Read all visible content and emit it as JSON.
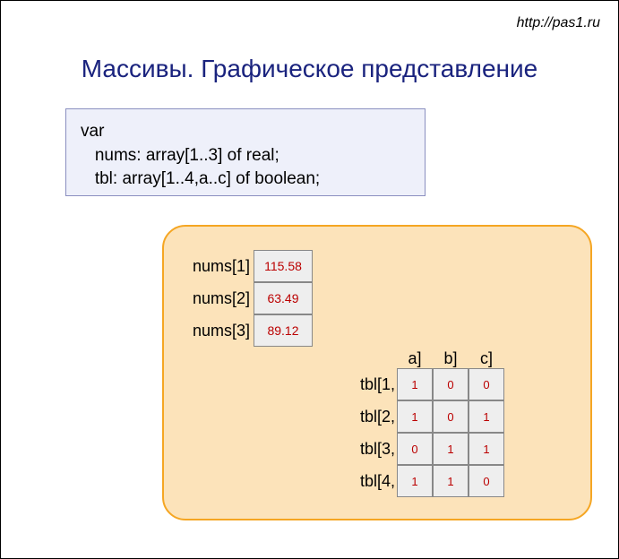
{
  "url_text": "http://pas1.ru",
  "title": "Массивы. Графическое представление",
  "code": {
    "line1": "var",
    "line2": "   nums: array[1..3] of real;",
    "line3": "   tbl: array[1..4,a..c] of boolean;"
  },
  "nums": [
    {
      "label": "nums[1]",
      "value": "115.58"
    },
    {
      "label": "nums[2]",
      "value": "63.49"
    },
    {
      "label": "nums[3]",
      "value": "89.12"
    }
  ],
  "tbl": {
    "col_headers": [
      "a]",
      "b]",
      "c]"
    ],
    "rows": [
      {
        "label": "tbl[1,",
        "cells": [
          "1",
          "0",
          "0"
        ]
      },
      {
        "label": "tbl[2,",
        "cells": [
          "1",
          "0",
          "1"
        ]
      },
      {
        "label": "tbl[3,",
        "cells": [
          "0",
          "1",
          "1"
        ]
      },
      {
        "label": "tbl[4,",
        "cells": [
          "1",
          "1",
          "0"
        ]
      }
    ]
  }
}
